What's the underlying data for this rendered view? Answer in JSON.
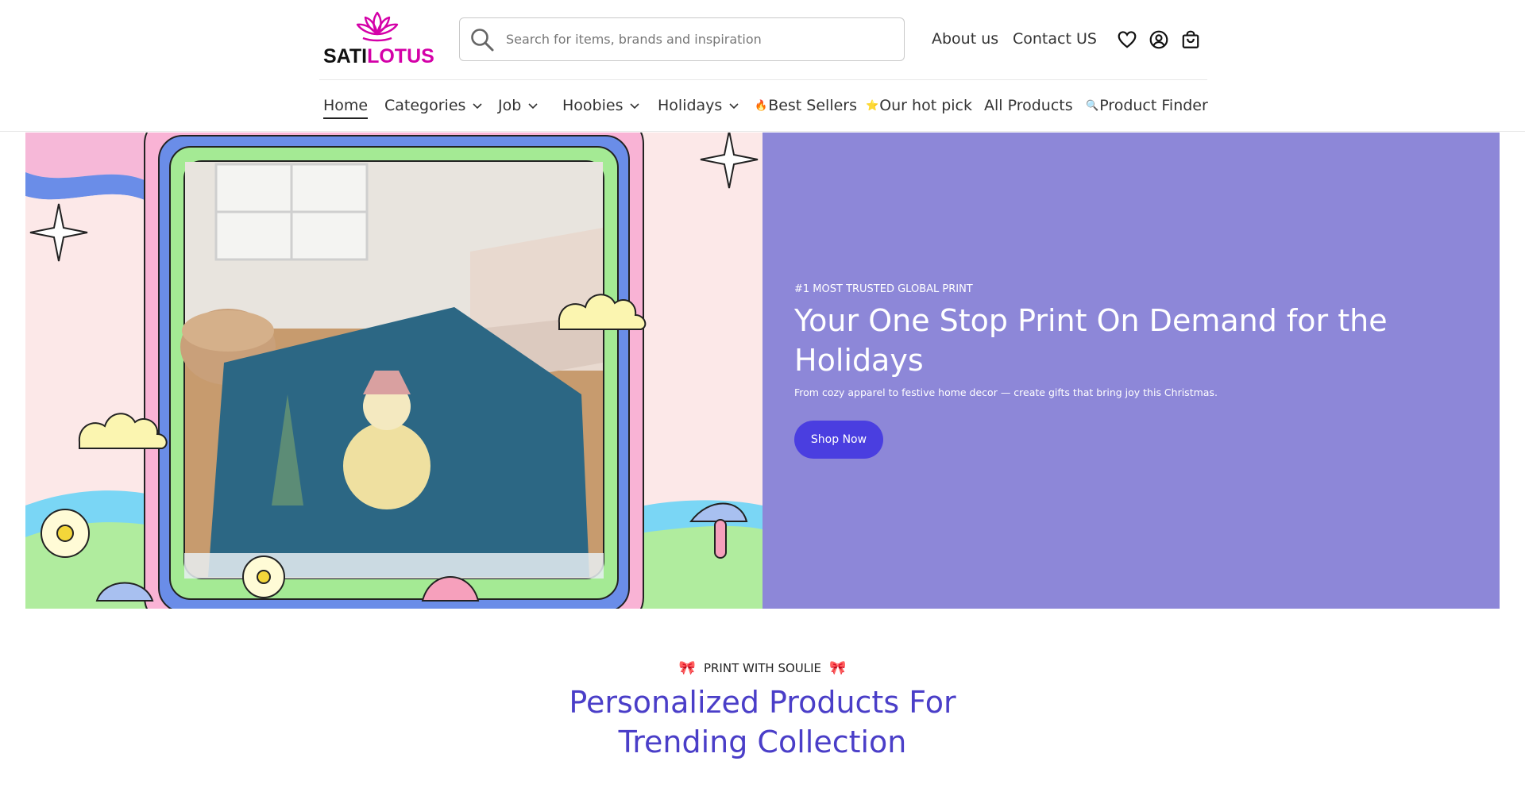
{
  "brand": {
    "name_part1": "SATI",
    "name_part2": "LOTUS",
    "accent_color": "#d400a8"
  },
  "search": {
    "placeholder": "Search for items, brands and inspiration",
    "value": ""
  },
  "top_links": {
    "about": "About us",
    "contact": "Contact US"
  },
  "header_icons": [
    "heart-icon",
    "user-icon",
    "bag-icon"
  ],
  "nav": {
    "home": "Home",
    "categories": "Categories",
    "job": "Job",
    "hoobies": "Hoobies",
    "holidays": "Holidays",
    "best_sellers_emoji": "🔥",
    "best_sellers": "Best Sellers",
    "hot_pick_emoji": "⭐",
    "hot_pick": "Our hot pick",
    "all_products": "All Products",
    "finder_emoji": "🔍",
    "finder": "Product Finder"
  },
  "hero": {
    "eyebrow": "#1 MOST TRUSTED GLOBAL PRINT",
    "title": "Your One Stop Print On Demand for the Holidays",
    "subtitle": "From cozy apparel to festive home decor — create gifts that bring joy this Christmas.",
    "button": "Shop Now",
    "panel_color": "#8d87d8",
    "button_color": "#4a3ee0"
  },
  "section": {
    "eyebrow_icon": "🎀",
    "eyebrow": "PRINT WITH SOULIE",
    "title": "Personalized Products For Trending Collection",
    "title_color": "#4a3ec8"
  }
}
